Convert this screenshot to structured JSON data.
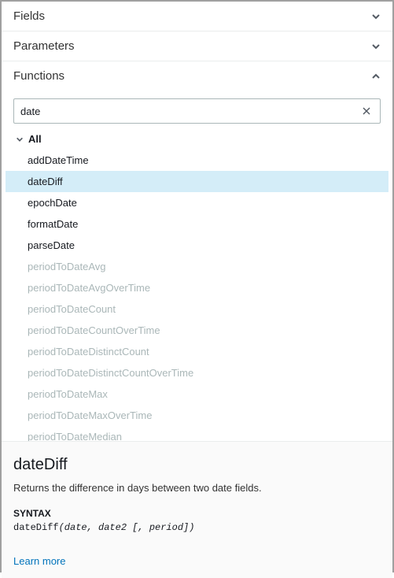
{
  "sections": {
    "fields": {
      "title": "Fields"
    },
    "parameters": {
      "title": "Parameters"
    },
    "functions": {
      "title": "Functions"
    }
  },
  "search": {
    "value": "date"
  },
  "categoryLabel": "All",
  "functionsList": [
    {
      "name": "addDateTime",
      "disabled": false,
      "selected": false
    },
    {
      "name": "dateDiff",
      "disabled": false,
      "selected": true
    },
    {
      "name": "epochDate",
      "disabled": false,
      "selected": false
    },
    {
      "name": "formatDate",
      "disabled": false,
      "selected": false
    },
    {
      "name": "parseDate",
      "disabled": false,
      "selected": false
    },
    {
      "name": "periodToDateAvg",
      "disabled": true,
      "selected": false
    },
    {
      "name": "periodToDateAvgOverTime",
      "disabled": true,
      "selected": false
    },
    {
      "name": "periodToDateCount",
      "disabled": true,
      "selected": false
    },
    {
      "name": "periodToDateCountOverTime",
      "disabled": true,
      "selected": false
    },
    {
      "name": "periodToDateDistinctCount",
      "disabled": true,
      "selected": false
    },
    {
      "name": "periodToDateDistinctCountOverTime",
      "disabled": true,
      "selected": false
    },
    {
      "name": "periodToDateMax",
      "disabled": true,
      "selected": false
    },
    {
      "name": "periodToDateMaxOverTime",
      "disabled": true,
      "selected": false
    },
    {
      "name": "periodToDateMedian",
      "disabled": true,
      "selected": false
    }
  ],
  "detail": {
    "title": "dateDiff",
    "description": "Returns the difference in days between two date fields.",
    "syntaxLabel": "SYNTAX",
    "syntaxFn": "dateDiff",
    "syntaxArgs": "(date, date2 [, period])",
    "learnMore": "Learn more"
  }
}
